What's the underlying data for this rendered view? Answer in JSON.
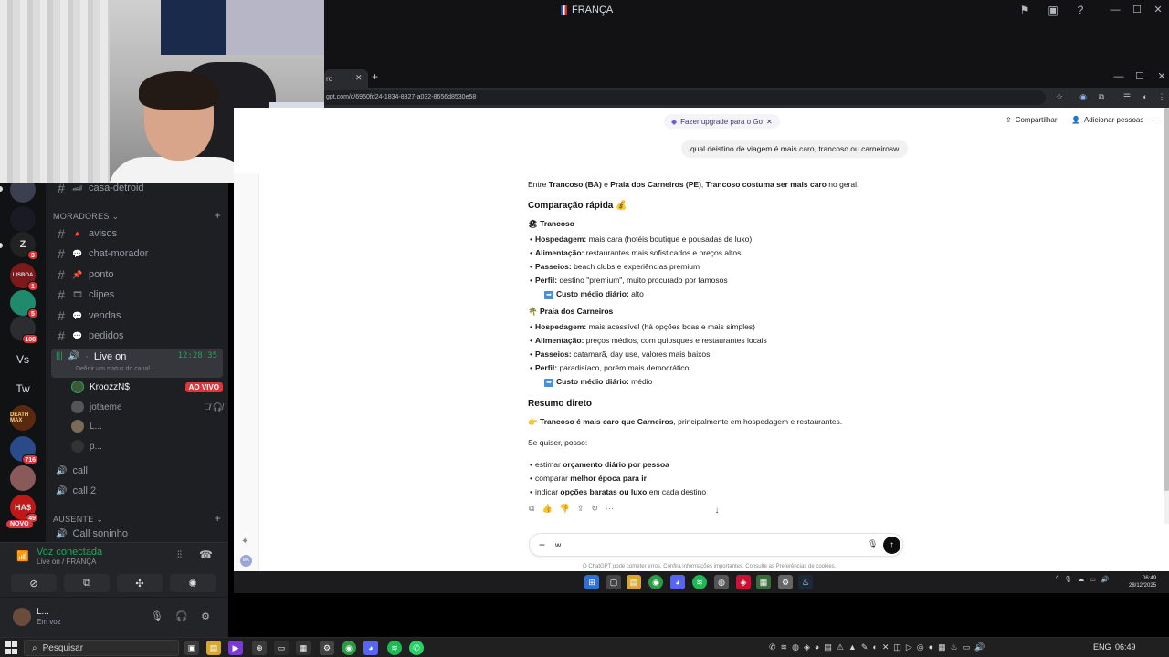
{
  "discord": {
    "window_title": "FRANÇA",
    "guilds": [
      {
        "label": "",
        "badge": ""
      },
      {
        "label": "",
        "badge": ""
      },
      {
        "label": "Z",
        "badge": "3"
      },
      {
        "label": "LISBOA",
        "badge": "1"
      },
      {
        "label": "",
        "badge": "5"
      },
      {
        "label": "",
        "badge": "108"
      },
      {
        "label": "Vs",
        "badge": ""
      },
      {
        "label": "Tw",
        "badge": ""
      },
      {
        "label": "DEATH MAX",
        "badge": ""
      },
      {
        "label": "",
        "badge": "716"
      },
      {
        "label": "",
        "badge": ""
      },
      {
        "label": "HA$",
        "badge": "49"
      }
    ],
    "new_badge": "NOVO",
    "channels_top": [
      {
        "name": "casa-detroid",
        "emoji": "🏎"
      }
    ],
    "category_moradores": "MORADORES",
    "channels_moradores": [
      {
        "name": "avisos",
        "emoji": "🔺"
      },
      {
        "name": "chat-morador",
        "emoji": "💬"
      },
      {
        "name": "ponto",
        "emoji": "📌"
      },
      {
        "name": "clipes",
        "emoji": "🎞"
      },
      {
        "name": "vendas",
        "emoji": "💬"
      },
      {
        "name": "pedidos",
        "emoji": "💬"
      }
    ],
    "live_channel": {
      "name": "Live on",
      "time": "12:28:35",
      "status": "Definir um status do canal"
    },
    "voice_users": [
      {
        "name": "KroozzN$",
        "live": "AO VIVO"
      },
      {
        "name": "jotaeme",
        "live": ""
      },
      {
        "name": "L...",
        "live": ""
      },
      {
        "name": "p...",
        "live": ""
      }
    ],
    "voice_channels": [
      "call",
      "call 2"
    ],
    "category_ausente": "AUSENTE",
    "channel_ausente": "Call soninho",
    "voice_status": {
      "label": "Voz conectada",
      "sub": "Live on / FRANÇA"
    },
    "user": {
      "name": "L...",
      "status": "Em voz"
    }
  },
  "browser": {
    "tab_title": "ro",
    "url": "gpt.com/c/6950fd24-1834-8327-a032-8656d8530e58"
  },
  "chatgpt": {
    "upgrade": "Fazer upgrade para o Go",
    "share": "Compartilhar",
    "add_people": "Adicionar pessoas",
    "user_message": "qual deistino de viagem é mais caro, trancoso ou carneirosw",
    "intro": {
      "a": "Entre ",
      "b": "Trancoso (BA)",
      "c": " e ",
      "d": "Praia dos Carneiros (PE)",
      "e": ", ",
      "f": "Trancoso costuma ser mais caro",
      "g": " no geral."
    },
    "heading_compare": "Comparação rápida 💰",
    "section1": {
      "title": "Trancoso",
      "items": [
        {
          "k": "Hospedagem:",
          "v": " mais cara (hotéis boutique e pousadas de luxo)"
        },
        {
          "k": "Alimentação:",
          "v": " restaurantes mais sofisticados e preços altos"
        },
        {
          "k": "Passeios:",
          "v": " beach clubs e experiências premium"
        },
        {
          "k": "Perfil:",
          "v": " destino \"premium\", muito procurado por famosos"
        }
      ],
      "cost_k": "Custo médio diário:",
      "cost_v": " alto"
    },
    "section2": {
      "title": "Praia dos Carneiros",
      "items": [
        {
          "k": "Hospedagem:",
          "v": " mais acessível (há opções boas e mais simples)"
        },
        {
          "k": "Alimentação:",
          "v": " preços médios, com quiosques e restaurantes locais"
        },
        {
          "k": "Passeios:",
          "v": " catamarã, day use, valores mais baixos"
        },
        {
          "k": "Perfil:",
          "v": " paradisíaco, porém mais democrático"
        }
      ],
      "cost_k": "Custo médio diário:",
      "cost_v": " médio"
    },
    "heading_summary": "Resumo direto",
    "summary": {
      "b": "Trancoso é mais caro que Carneiros",
      "r": ", principalmente em hospedagem e restaurantes."
    },
    "offer_intro": "Se quiser, posso:",
    "offers": [
      {
        "a": "estimar ",
        "b": "orçamento diário por pessoa",
        "c": ""
      },
      {
        "a": "comparar ",
        "b": "melhor época para ir",
        "c": ""
      },
      {
        "a": "indicar ",
        "b": "opções baratas ou luxo",
        "c": " em cada destino"
      }
    ],
    "composer_value": "w",
    "disclaimer": "O ChatGPT pode cometer erros. Confira informações importantes. Consulte as Preferências de cookies."
  },
  "inner_taskbar": {
    "time": "06:49",
    "date": "28/12/2025"
  },
  "taskbar": {
    "search": "Pesquisar",
    "lang": "ENG",
    "time": "06:49"
  }
}
